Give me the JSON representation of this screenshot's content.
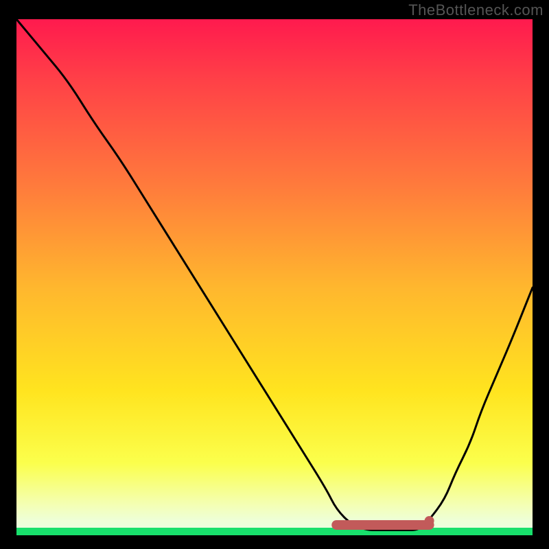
{
  "watermark": "TheBottleneck.com",
  "colors": {
    "background": "#000000",
    "gradient_top": "#ff1a4e",
    "gradient_mid": "#ffe41f",
    "gradient_bottom": "#eeffd6",
    "green_band": "#18e06c",
    "curve": "#000000",
    "marker": "#c25a5a"
  },
  "chart_data": {
    "type": "line",
    "title": "",
    "xlabel": "",
    "ylabel": "",
    "xlim": [
      0,
      100
    ],
    "ylim": [
      0,
      100
    ],
    "annotations": [],
    "series": [
      {
        "name": "bottleneck-curve",
        "x": [
          0,
          5,
          10,
          15,
          20,
          25,
          30,
          35,
          40,
          45,
          50,
          55,
          60,
          62,
          65,
          68,
          70,
          73,
          75,
          78,
          80,
          83,
          85,
          88,
          90,
          93,
          96,
          100
        ],
        "values": [
          100,
          94,
          88,
          80,
          73,
          65,
          57,
          49,
          41,
          33,
          25,
          17,
          9,
          5,
          2,
          1,
          1,
          1,
          1,
          1,
          3,
          7,
          12,
          18,
          24,
          31,
          38,
          48
        ]
      }
    ],
    "markers": [
      {
        "name": "minimum-band-start",
        "x": 62,
        "y": 2
      },
      {
        "name": "minimum-band-end",
        "x": 80,
        "y": 2
      }
    ]
  }
}
